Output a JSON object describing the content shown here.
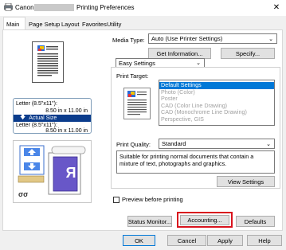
{
  "window": {
    "title_left": "Canon",
    "title_right": "Printing Preferences"
  },
  "tabs": [
    {
      "label": "Main"
    },
    {
      "label": "Page Setup"
    },
    {
      "label": "Layout"
    },
    {
      "label": "Favorites"
    },
    {
      "label": "Utility"
    }
  ],
  "preview": {
    "paper_label_1": "Letter (8.5\"x11\"):",
    "paper_size_1": "8.50 in x 11.00 in",
    "actual_size_label": "Actual Size",
    "paper_label_2": "Letter (8.5\"x11\"):",
    "paper_size_2": "8.50 in x 11.00 in",
    "output_letter": "R"
  },
  "media_type": {
    "label": "Media Type:",
    "value": "Auto (Use Printer Settings)"
  },
  "buttons": {
    "get_information": "Get Information...",
    "specify": "Specify...",
    "view_settings": "View Settings",
    "status_monitor": "Status Monitor...",
    "accounting": "Accounting...",
    "defaults": "Defaults",
    "ok": "OK",
    "cancel": "Cancel",
    "apply": "Apply",
    "help": "Help"
  },
  "settings_mode": {
    "value": "Easy Settings"
  },
  "print_target": {
    "label": "Print Target:",
    "items": [
      {
        "label": "Default Settings",
        "selected": true,
        "disabled": false
      },
      {
        "label": "Photo (Color)",
        "selected": false,
        "disabled": true
      },
      {
        "label": "Poster",
        "selected": false,
        "disabled": true
      },
      {
        "label": "CAD (Color Line Drawing)",
        "selected": false,
        "disabled": true
      },
      {
        "label": "CAD (Monochrome Line Drawing)",
        "selected": false,
        "disabled": true
      },
      {
        "label": "Perspective, GIS",
        "selected": false,
        "disabled": true
      }
    ]
  },
  "print_quality": {
    "label": "Print Quality:",
    "value": "Standard"
  },
  "description": "Suitable for printing normal documents that contain a mixture of text, photographs and graphics.",
  "preview_before_printing": {
    "label": "Preview before printing",
    "checked": false
  },
  "colors": {
    "highlight": "#0078d7",
    "accounting_outline": "#d9131d",
    "actual_size_bar": "#0b3c8c"
  }
}
